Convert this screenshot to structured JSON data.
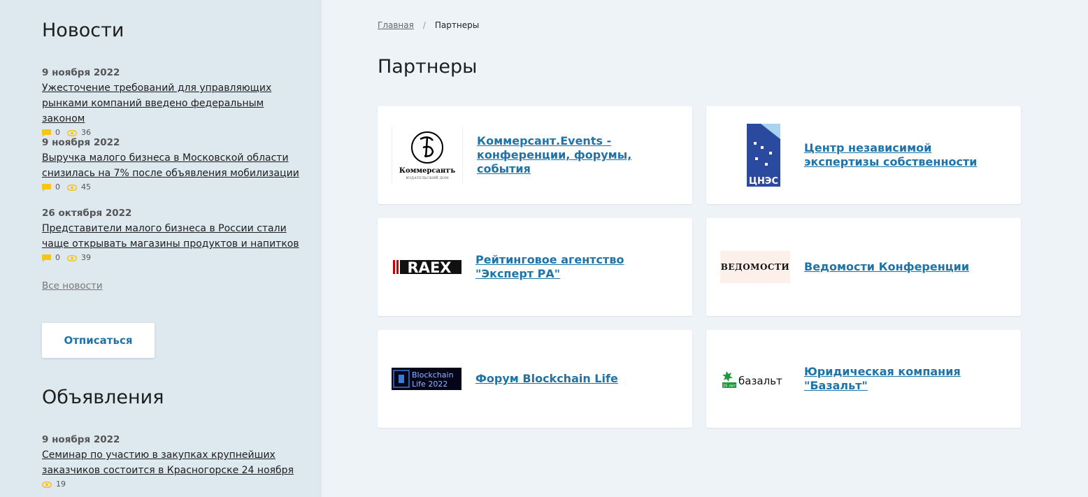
{
  "sidebar": {
    "news_title": "Новости",
    "news": [
      {
        "date": "9 ноября 2022",
        "title": "Ужесточение требований для управляющих рынками компаний введено федеральным законом",
        "comments": "0",
        "views": "36"
      },
      {
        "date": "9 ноября 2022",
        "title": "Выручка малого бизнеса в Московской области снизилась на 7% после объявления мобилизации",
        "comments": "0",
        "views": "45"
      },
      {
        "date": "26 октября 2022",
        "title": "Представители малого бизнеса в России стали чаще открывать магазины продуктов и напитков",
        "comments": "0",
        "views": "39"
      }
    ],
    "all_news": "Все новости",
    "unsubscribe": "Отписаться",
    "ads_title": "Объявления",
    "ads": [
      {
        "date": "9 ноября 2022",
        "title": "Семинар по участию в закупках крупнейших заказчиков состоится в Красногорске 24 ноября",
        "views": "19"
      }
    ]
  },
  "breadcrumb": {
    "home": "Главная",
    "separator": "/",
    "current": "Партнеры"
  },
  "page_title": "Партнеры",
  "partners": [
    {
      "name": "Коммерсант.Events - конференции, форумы, события",
      "logo_text": "Коммерсантъ",
      "logo_sub": "ИЗДАТЕЛЬСКИЙ ДОМ"
    },
    {
      "name": "Центр независимой экспертизы собственности",
      "logo_text": "ЦНЭС"
    },
    {
      "name": "Рейтинговое агентство \"Эксперт РА\"",
      "logo_text": "RAEX"
    },
    {
      "name": "Ведомости Конференции",
      "logo_text": "ВЕДОМОСТИ"
    },
    {
      "name": "Форум Blockchain Life",
      "logo_text_1": "Blockchain",
      "logo_text_2": "Life 2022"
    },
    {
      "name": "Юридическая компания \"Базальт\"",
      "logo_text": "базальт",
      "logo_badge": "25 лет"
    }
  ],
  "colors": {
    "accent": "#1e73a8",
    "sidebar_bg": "#dde8ef",
    "page_bg": "#eef3f7",
    "stat_icon": "#f5c518"
  }
}
